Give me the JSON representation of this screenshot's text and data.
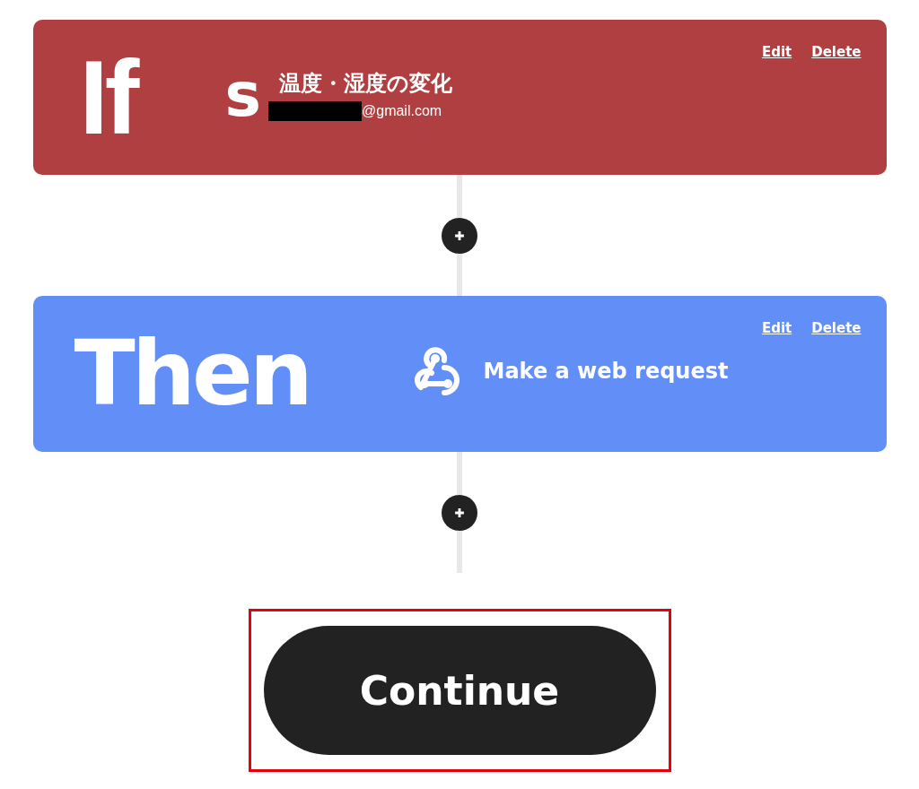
{
  "steps": [
    {
      "kind": "trigger",
      "keyword": "If",
      "service_glyph": "s",
      "title": "温度・湿度の変化",
      "account": "@gmail.com",
      "account_redacted": true,
      "actions": [
        "Edit",
        "Delete"
      ]
    },
    {
      "kind": "action",
      "keyword": "Then",
      "title": "Make a web request",
      "actions": [
        "Edit",
        "Delete"
      ]
    }
  ],
  "continue_button": {
    "label": "Continue",
    "highlighted": true
  }
}
